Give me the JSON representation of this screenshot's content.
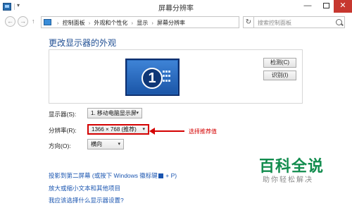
{
  "window": {
    "title": "屏幕分辨率",
    "min_glyph": "—",
    "close_glyph": "✕"
  },
  "nav": {
    "back_glyph": "←",
    "forward_glyph": "→",
    "up_glyph": "↑",
    "crumbs": [
      "控制面板",
      "外观和个性化",
      "显示",
      "屏幕分辨率"
    ],
    "crumb_separator": "›",
    "dropdown_glyph": "▾",
    "refresh_glyph": "↻",
    "search_placeholder": "搜索控制面板"
  },
  "main": {
    "heading": "更改显示器的外观",
    "monitor_number": "1",
    "detect_button": "检测(C)",
    "identify_button": "识别(I)",
    "display_label": "显示器(S):",
    "display_value": "1. 移动电脑显示屏",
    "resolution_label": "分辨率(R):",
    "resolution_value": "1366 × 768 (推荐)",
    "orientation_label": "方向(O):",
    "orientation_value": "横向",
    "caret": "▾",
    "annotation": "选择推荐值",
    "links": {
      "project_prefix": "投影到第二屏幕 (或按下 Windows 徽标键",
      "project_suffix": " + P)",
      "text_size": "放大或缩小文本和其他项目",
      "which_setting": "我应该选择什么显示器设置?"
    }
  },
  "watermark": {
    "title": "百科全说",
    "subtitle": "助你轻松解决"
  },
  "colors": {
    "accent": "#1f4e93",
    "link": "#1a55b0",
    "highlight": "#d40000",
    "watermark": "#128c4e"
  }
}
